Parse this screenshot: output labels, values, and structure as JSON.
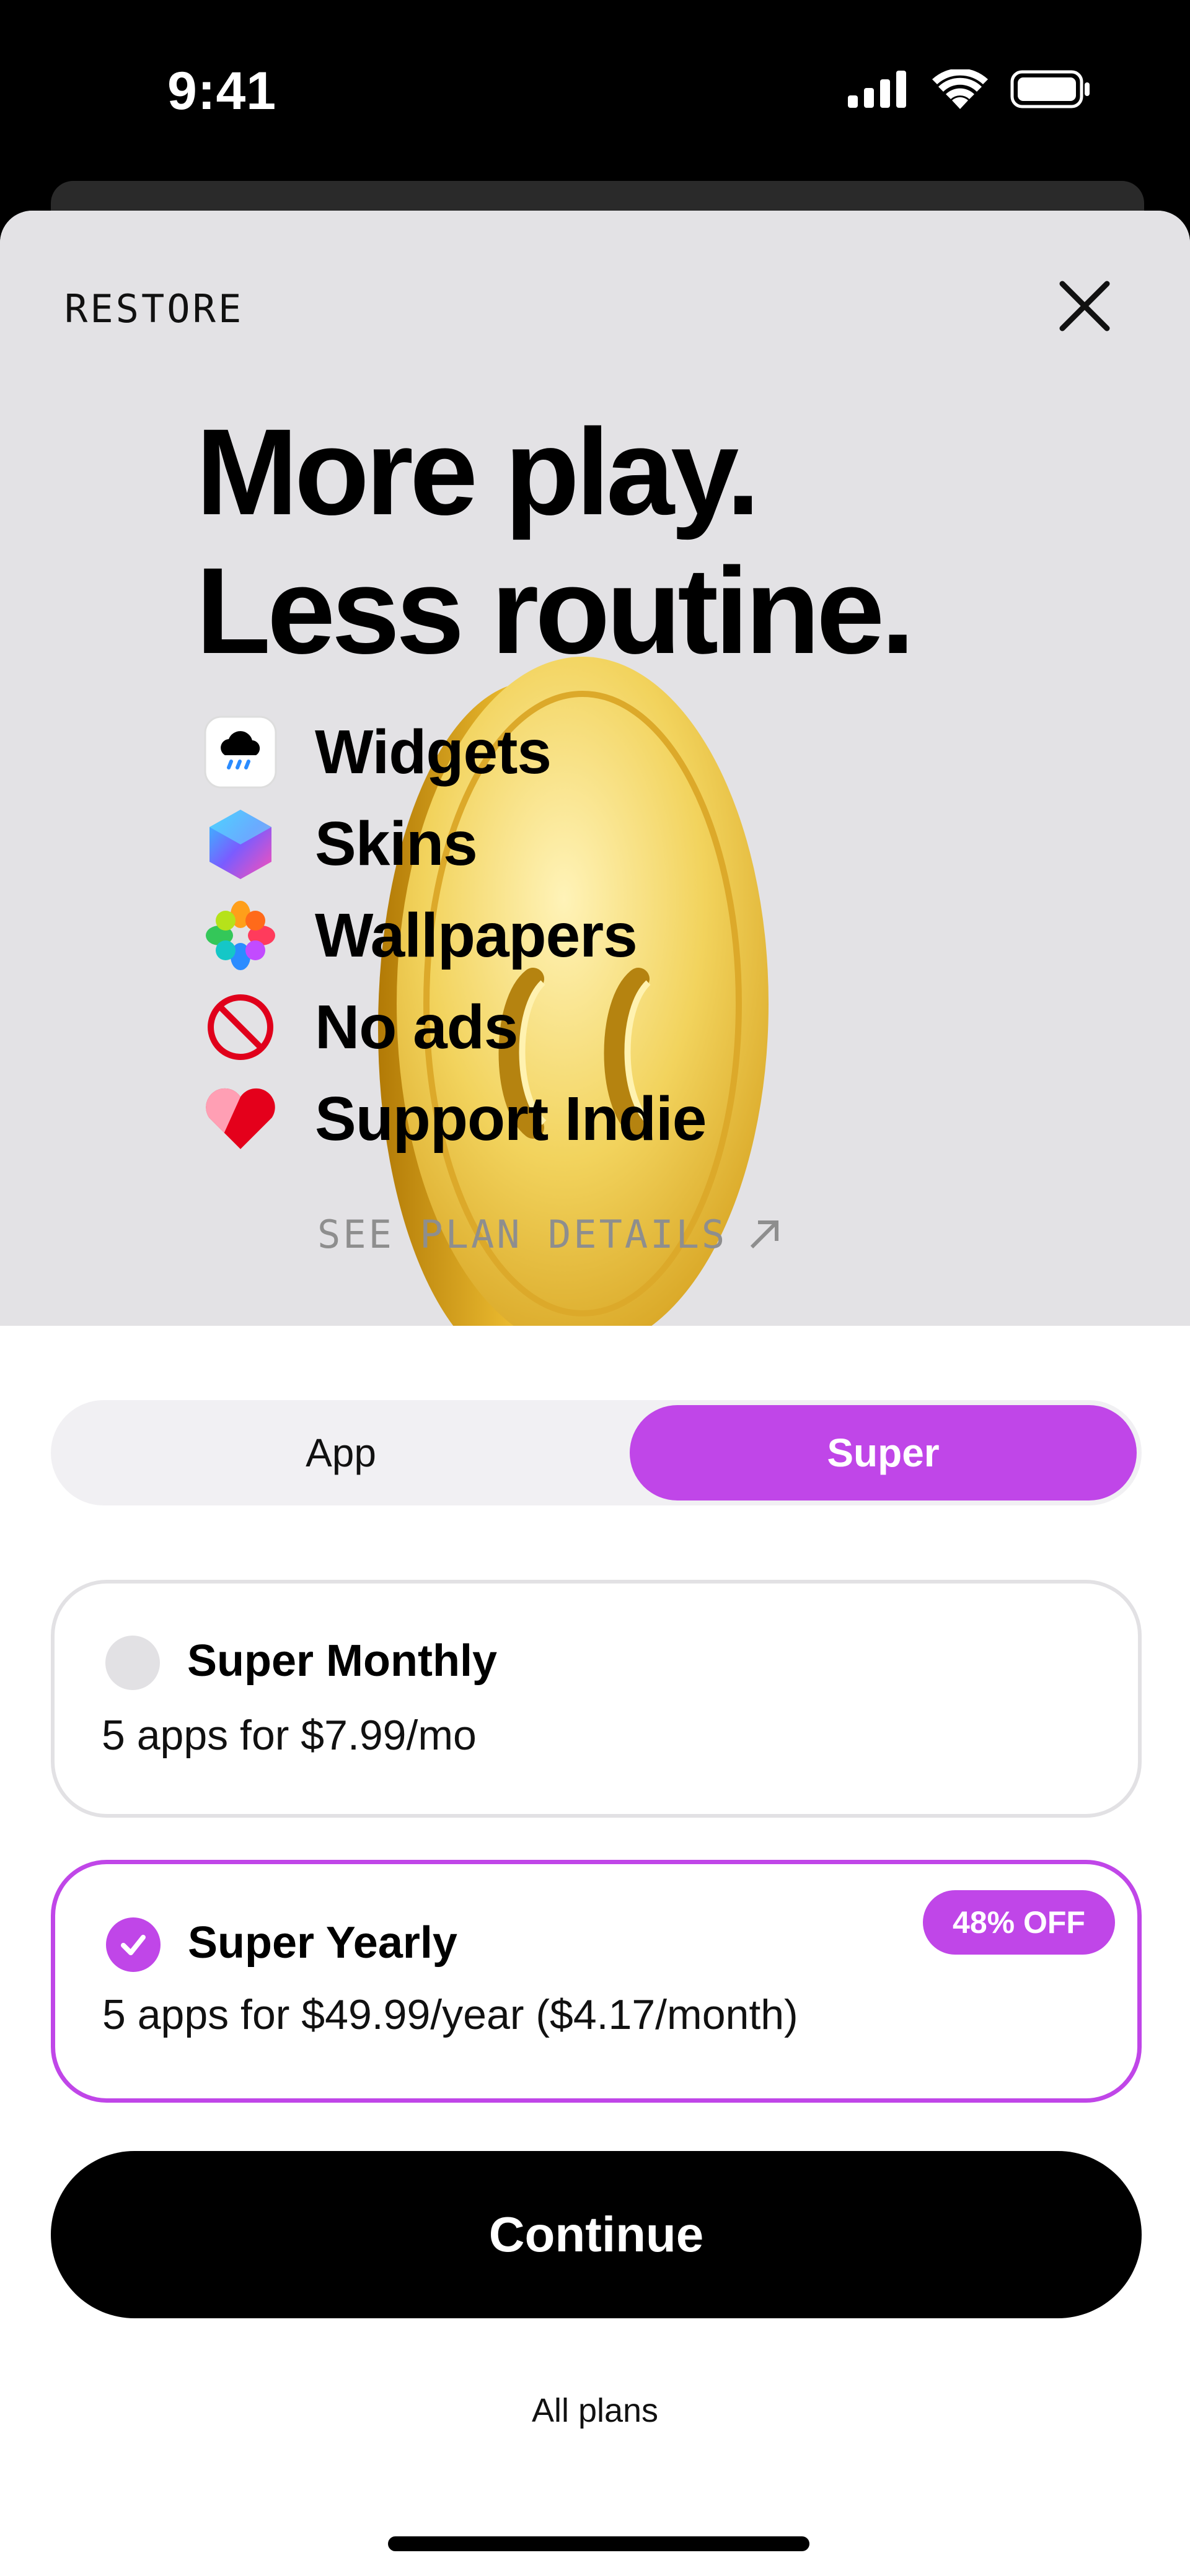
{
  "status_bar": {
    "time": "9:41"
  },
  "header": {
    "restore_label": "RESTORE"
  },
  "hero": {
    "headline_line1": "More play.",
    "headline_line2": "Less routine.",
    "features": [
      {
        "label": "Widgets",
        "icon": "cloud-rain-widget-icon"
      },
      {
        "label": "Skins",
        "icon": "hexagon-cube-icon"
      },
      {
        "label": "Wallpapers",
        "icon": "flower-icon"
      },
      {
        "label": "No ads",
        "icon": "prohibited-icon"
      },
      {
        "label": "Support Indie",
        "icon": "heart-icon"
      }
    ],
    "plan_details_label": "SEE PLAN DETAILS"
  },
  "segmented": {
    "options": [
      "App",
      "Super"
    ],
    "selected": "Super"
  },
  "plans": [
    {
      "title": "Super Monthly",
      "description": "5 apps for $7.99/mo",
      "selected": false
    },
    {
      "title": "Super Yearly",
      "description": "5 apps for $49.99/year ($4.17/month)",
      "badge": "48% OFF",
      "selected": true
    }
  ],
  "cta": {
    "continue_label": "Continue",
    "all_plans_label": "All plans"
  },
  "colors": {
    "accent": "#c046e8",
    "hero_bg": "#e3e2e5",
    "coin": "#e8b21c"
  }
}
